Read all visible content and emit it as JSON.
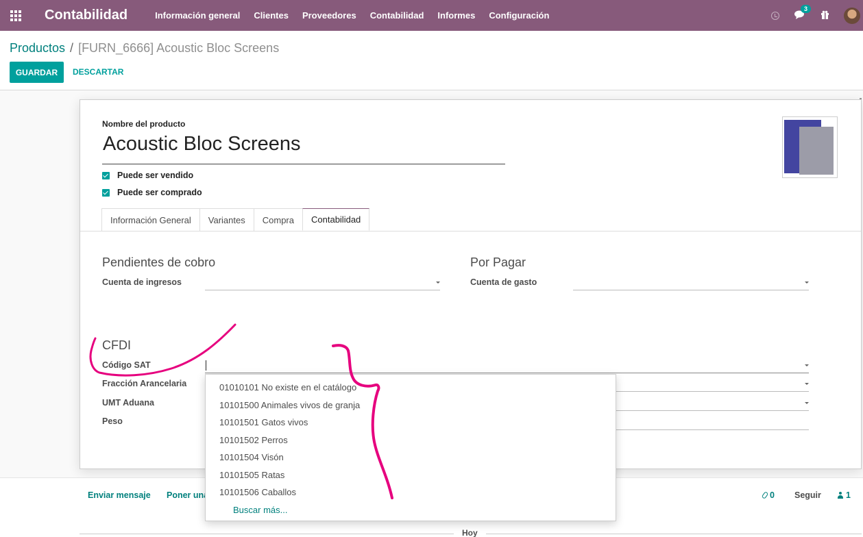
{
  "navbar": {
    "app_name": "Contabilidad",
    "menu": [
      "Información general",
      "Clientes",
      "Proveedores",
      "Contabilidad",
      "Informes",
      "Configuración"
    ],
    "messages_count": "3",
    "icons": [
      "apps-grid-icon",
      "clock-icon",
      "chat-icon",
      "gift-icon",
      "avatar"
    ]
  },
  "breadcrumb": {
    "parent": "Productos",
    "separator": "/",
    "current": "[FURN_6666] Acoustic Bloc Screens"
  },
  "buttons": {
    "save": "GUARDAR",
    "discard": "DESCARTAR"
  },
  "form": {
    "name_label": "Nombre del producto",
    "name_value": "Acoustic Bloc Screens",
    "can_be_sold": "Puede ser vendido",
    "can_be_purchased": "Puede ser comprado",
    "tabs": [
      "Información General",
      "Variantes",
      "Compra",
      "Contabilidad"
    ],
    "active_tab": "Contabilidad",
    "receivables_title": "Pendientes de cobro",
    "income_account_label": "Cuenta de ingresos",
    "payables_title": "Por Pagar",
    "expense_account_label": "Cuenta de gasto",
    "cfdi_title": "CFDI",
    "sat_code_label": "Código SAT",
    "tariff_label": "Fracción Arancelaria",
    "umt_label": "UMT Aduana",
    "weight_label": "Peso"
  },
  "dropdown": {
    "options": [
      "01010101 No existe en el catálogo",
      "10101500 Animales vivos de granja",
      "10101501 Gatos vivos",
      "10101502 Perros",
      "10101504 Visón",
      "10101505 Ratas",
      "10101506 Caballos"
    ],
    "search_more": "Buscar más..."
  },
  "chatter": {
    "send_message": "Enviar mensaje",
    "log_note": "Poner una",
    "attachments": "0",
    "follow": "Seguir",
    "followers": "1",
    "today": "Hoy"
  },
  "colors": {
    "navbar": "#875a7b",
    "primary": "#00a09d",
    "link": "#00807d",
    "annotation": "#e6007e"
  }
}
